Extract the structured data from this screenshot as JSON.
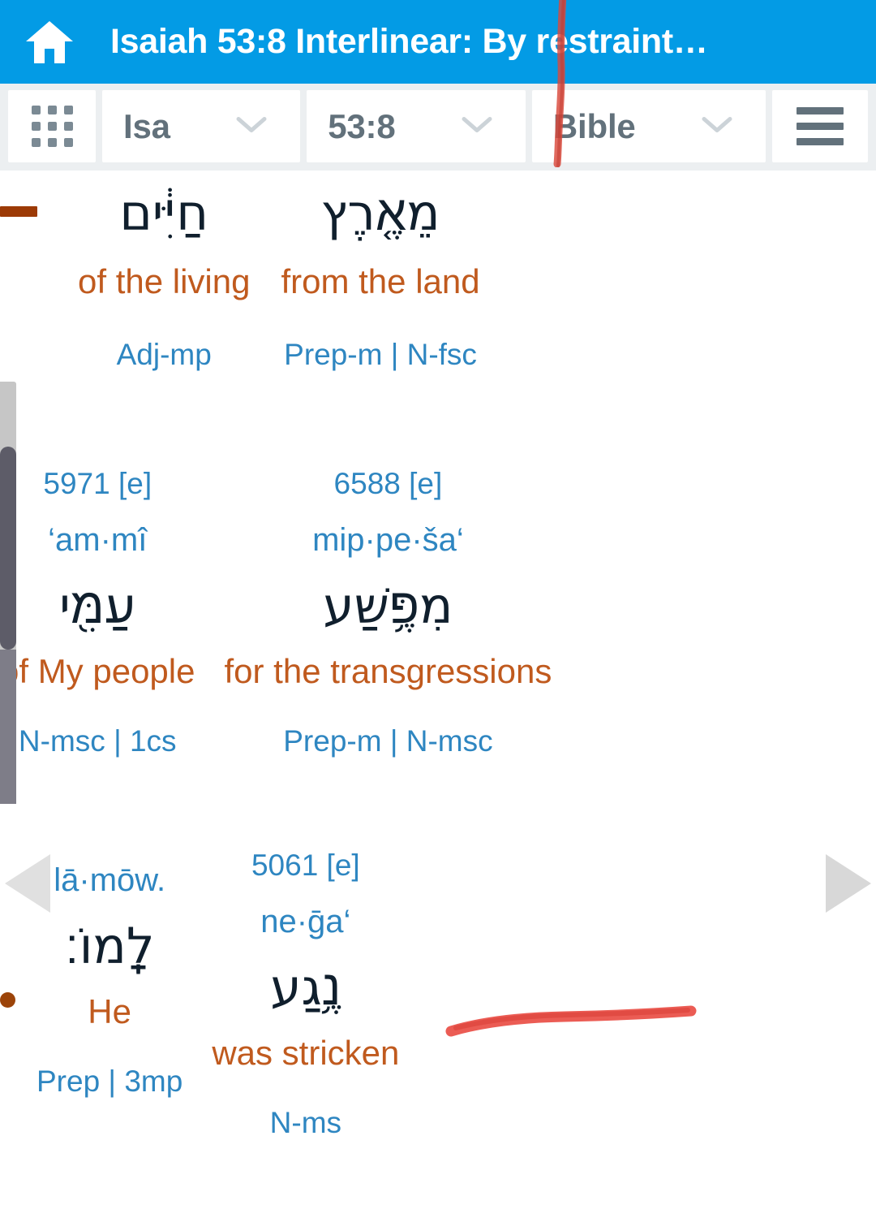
{
  "titlebar": {
    "home_icon": "home-icon",
    "title": "Isaiah 53:8 Interlinear: By restraint…"
  },
  "toolbar": {
    "apps_icon": "grid-dots-icon",
    "book": "Isa",
    "verse": "53:8",
    "resource": "Bible",
    "menu_icon": "hamburger-icon",
    "chevron_icon": "chevron-down-icon"
  },
  "nav": {
    "prev_icon": "triangle-left-icon",
    "next_icon": "triangle-right-icon"
  },
  "annotations": {
    "vertical_stroke_color": "#d9493c",
    "underline_stroke_color": "#e8453c"
  },
  "colors": {
    "header_blue": "#039be5",
    "toolbar_bg": "#eceff1",
    "hebrew": "#101f2d",
    "gloss_orange": "#c05a1e",
    "link_blue": "#2e86c1",
    "maqqef_brown": "#9c3a06"
  },
  "interlinear": {
    "rows": [
      {
        "words": [
          {
            "strongs": "",
            "translit": "",
            "hebrew": "מֵאֶ֤רֶץ",
            "gloss": "from the land",
            "parse": "Prep-m | N-fsc"
          },
          {
            "strongs": "",
            "translit": "",
            "hebrew": "חַיִּ֔ים",
            "gloss": "of the living",
            "parse": "Adj-mp"
          },
          {
            "strongs": "",
            "translit": "",
            "hebrew": "—",
            "gloss": "",
            "parse": ""
          }
        ]
      },
      {
        "words": [
          {
            "strongs": "6588 [e]",
            "translit": "mip·pe·ša‘",
            "hebrew": "מִפֶּ֥שַׁע",
            "gloss": "for the transgressions",
            "parse": "Prep-m | N-msc"
          },
          {
            "strongs": "5971 [e]",
            "translit": "‘am·mî",
            "hebrew": "עַמִּ֖י",
            "gloss": "of My people",
            "parse": "N-msc | 1cs"
          }
        ]
      },
      {
        "words": [
          {
            "strongs": "5061 [e]",
            "translit": "ne·ḡa‘",
            "hebrew": "נֶ֥גַע",
            "gloss": "was stricken",
            "parse": "N-ms"
          },
          {
            "strongs": "",
            "translit": "lā·mōw.",
            "hebrew": "לָֽמוֹ׃",
            "gloss": "He",
            "parse": "Prep | 3mp"
          }
        ]
      }
    ]
  }
}
